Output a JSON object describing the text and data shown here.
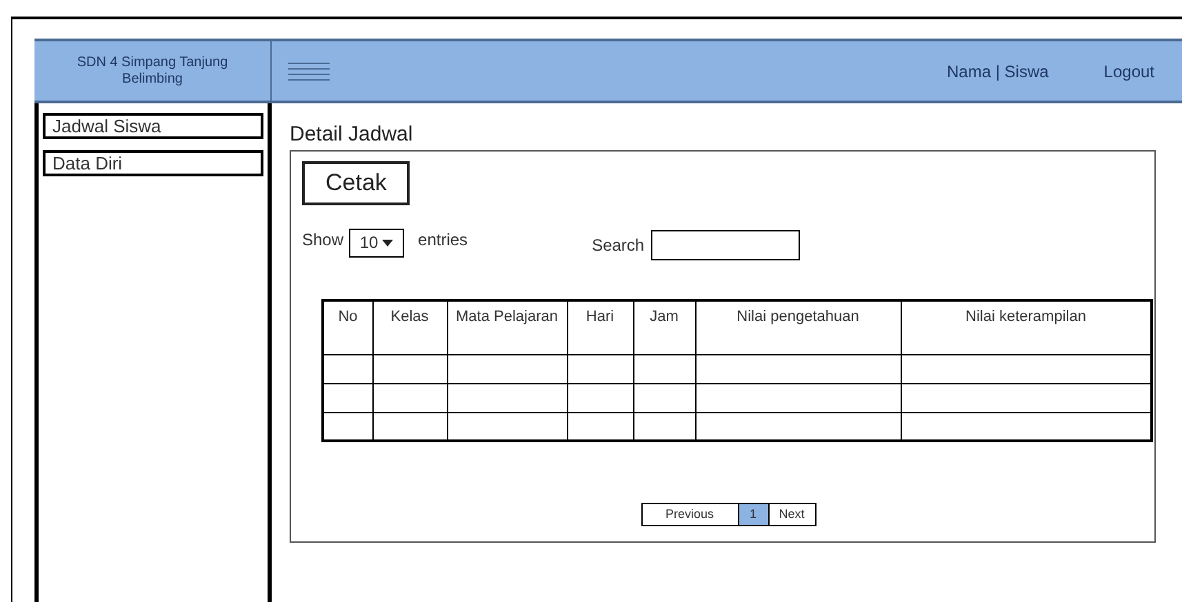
{
  "header": {
    "brand": "SDN 4 Simpang Tanjung Belimbing",
    "user": "Nama | Siswa",
    "logout": "Logout"
  },
  "sidebar": {
    "items": [
      "Jadwal Siswa",
      "Data Diri"
    ]
  },
  "page_title": "Detail Jadwal",
  "print_button": "Cetak",
  "length": {
    "show": "Show",
    "value": "10",
    "suffix": "entries"
  },
  "search": {
    "label": "Search"
  },
  "table": {
    "columns": [
      "No",
      "Kelas",
      "Mata Pelajaran",
      "Hari",
      "Jam",
      "Nilai pengetahuan",
      "Nilai keterampilan"
    ]
  },
  "pagination": {
    "previous": "Previous",
    "pages": [
      {
        "label": "1",
        "selected": true
      }
    ],
    "next": "Next"
  }
}
